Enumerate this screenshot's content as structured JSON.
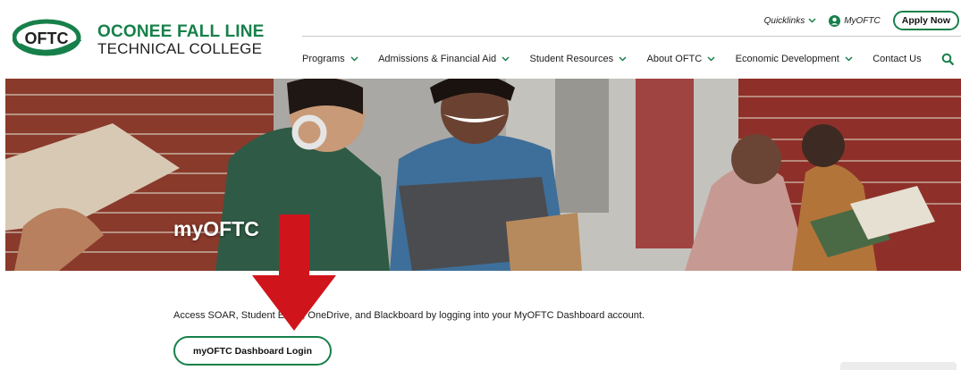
{
  "brand": {
    "logo_abbr": "OFTC",
    "name_line1": "OCONEE FALL LINE",
    "name_line2": "TECHNICAL COLLEGE",
    "primary_color": "#17804a"
  },
  "utility": {
    "quicklinks": "Quicklinks",
    "myoftc": "MyOFTC",
    "apply": "Apply Now"
  },
  "nav": {
    "items": [
      "Programs",
      "Admissions & Financial Aid",
      "Student Resources",
      "About OFTC",
      "Economic Development",
      "Contact Us"
    ],
    "search_icon": "search-icon"
  },
  "hero": {
    "title": "myOFTC"
  },
  "content": {
    "description": "Access SOAR, Student Email, OneDrive, and Blackboard by logging into your MyOFTC Dashboard account.",
    "login_button": "myOFTC Dashboard Login",
    "annotation_arrow_color": "#d0141c"
  }
}
